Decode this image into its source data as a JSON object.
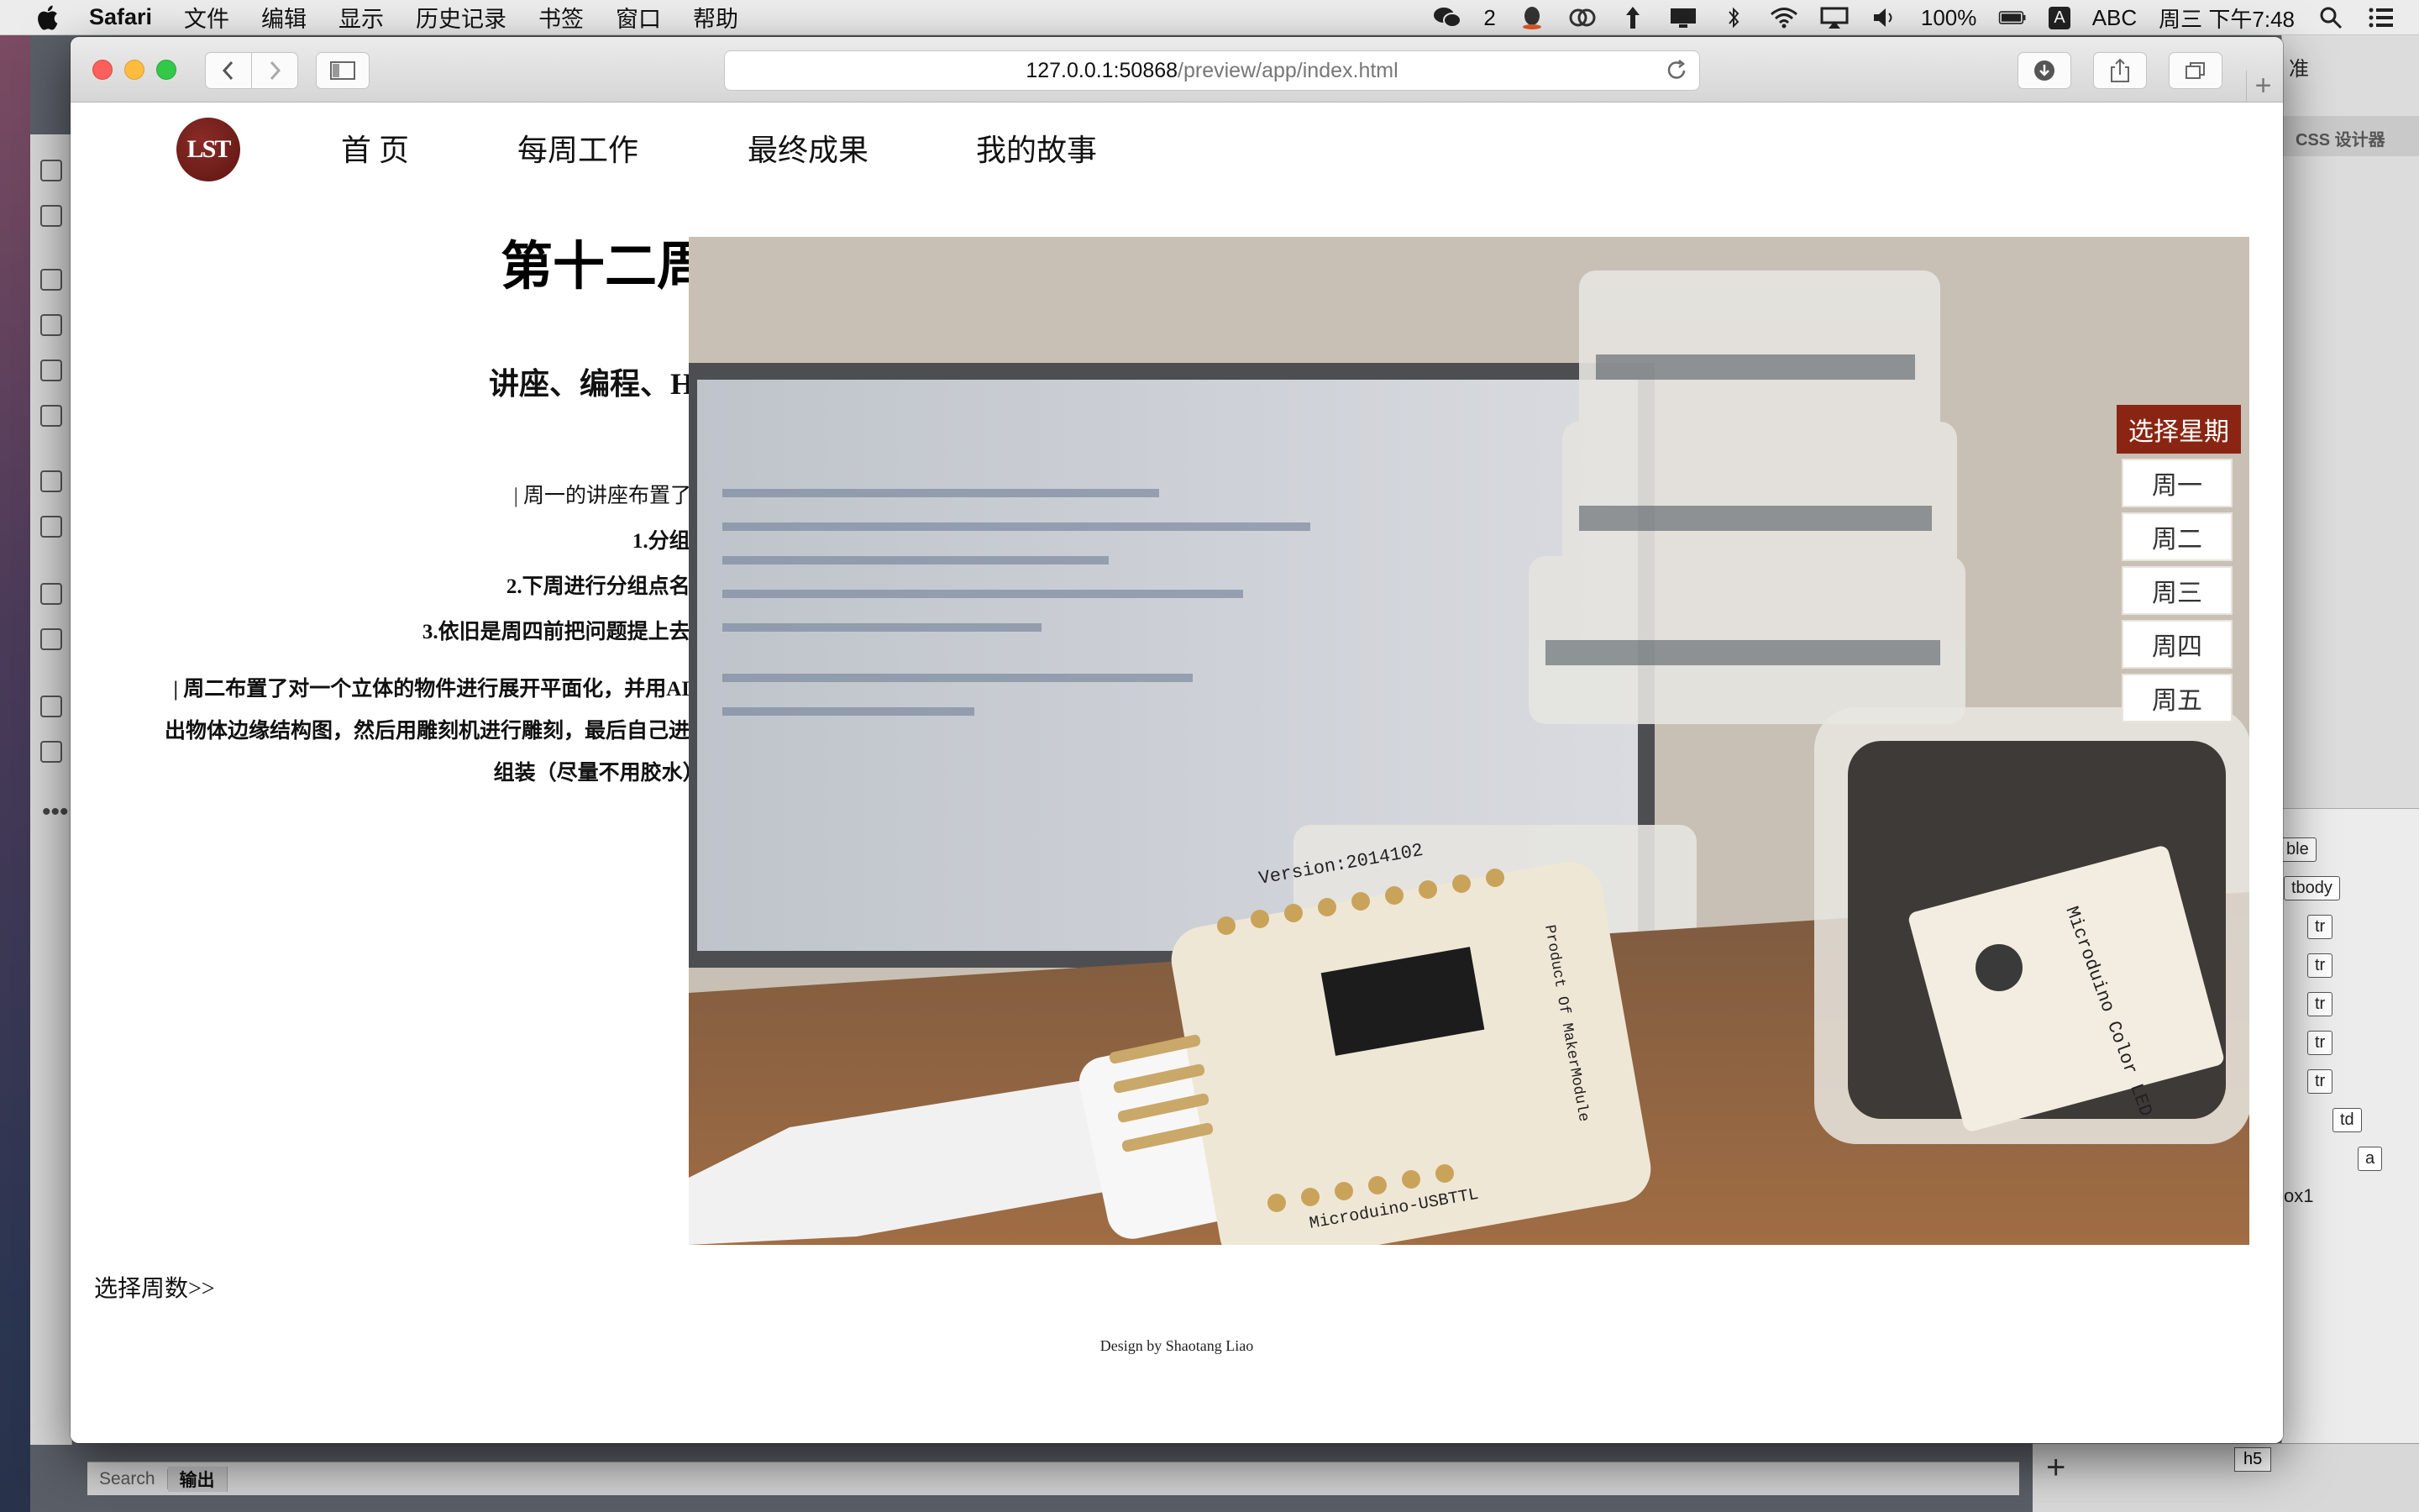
{
  "menubar": {
    "app_name": "Safari",
    "items": [
      "文件",
      "编辑",
      "显示",
      "历史记录",
      "书签",
      "窗口",
      "帮助"
    ],
    "wechat_badge": "2",
    "battery": "100%",
    "input_method": "A",
    "input_label": "ABC",
    "clock": "周三 下午7:48"
  },
  "background_app": {
    "panel_title": "CSS 设计器",
    "panel_partial": "准",
    "dom_tags": [
      "ble",
      "tbody",
      "tr",
      "tr",
      "tr",
      "tr",
      "tr",
      "td",
      "a"
    ],
    "dom_id": "ox1",
    "bottom_tabs": [
      "Search",
      "输出"
    ],
    "selected_tag": "h5"
  },
  "browser": {
    "url_host": "127.0.0.1:50868",
    "url_path": "/preview/app/index.html"
  },
  "page": {
    "logo_text": "LST",
    "nav": [
      "首 页",
      "每周工作",
      "最终成果",
      "我的故事"
    ],
    "week_title": "第十二周",
    "week_subtitle": "讲座、编程、H5",
    "lecture_lines": [
      "| 周一的讲座布置了:",
      "1.分组;",
      "2.下周进行分组点名;",
      "3.依旧是周四前把问题提上去;"
    ],
    "tuesday_text": "| 周二布置了对一个立体的物件进行展开平面化，并用AI勾出物体边缘结构图，然后用雕刻机进行雕刻，最后自己进行组装（尽量不用胶水）;",
    "photo_board_text": [
      "Version:2014102",
      "Product Of MakerModule",
      "Microduino-USBTTL"
    ],
    "photo_module_text": [
      "Microduino Color LED"
    ],
    "week_picker": {
      "title": "选择星期",
      "days": [
        "周一",
        "周二",
        "周三",
        "周四",
        "周五"
      ]
    },
    "select_weeks": "选择周数>>",
    "credit": "Design by Shaotang Liao"
  },
  "colors": {
    "accent": "#8b2513",
    "logo": "#6e1c17"
  }
}
